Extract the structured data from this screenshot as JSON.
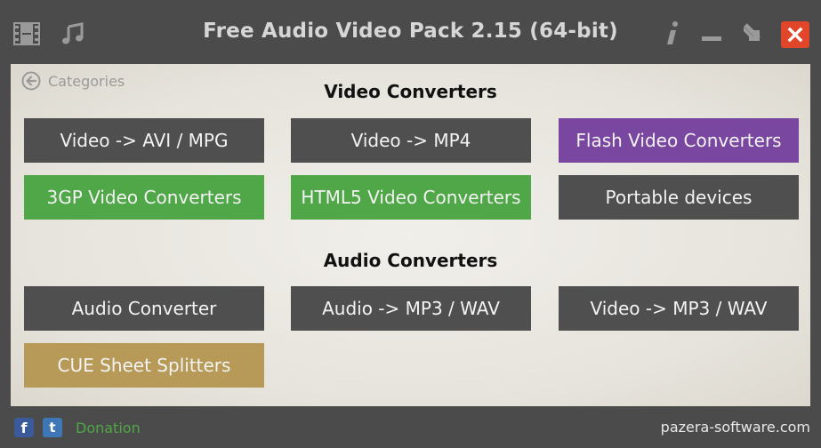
{
  "window": {
    "title": "Free Audio Video Pack 2.15 (64-bit)"
  },
  "titlebar_icons": [
    "film-icon",
    "music-note-icon",
    "info-icon",
    "minimize-icon",
    "restore-icon",
    "close-icon"
  ],
  "back": {
    "label": "Categories"
  },
  "video": {
    "heading": "Video Converters",
    "tiles": [
      {
        "label": "Video -> AVI / MPG",
        "color": "#4f4f4f"
      },
      {
        "label": "Video -> MP4",
        "color": "#4f4f4f"
      },
      {
        "label": "Flash Video Converters",
        "color": "#7a47a0"
      },
      {
        "label": "3GP Video Converters",
        "color": "#4fa747"
      },
      {
        "label": "HTML5 Video Converters",
        "color": "#4fa747"
      },
      {
        "label": "Portable devices",
        "color": "#4f4f4f"
      }
    ]
  },
  "audio": {
    "heading": "Audio Converters",
    "tiles": [
      {
        "label": "Audio Converter",
        "color": "#4f4f4f"
      },
      {
        "label": "Audio -> MP3 / WAV",
        "color": "#4f4f4f"
      },
      {
        "label": "Video -> MP3 / WAV",
        "color": "#4f4f4f"
      },
      {
        "label": "CUE Sheet Splitters",
        "color": "#b79a58"
      }
    ]
  },
  "footer": {
    "facebook_glyph": "f",
    "twitter_glyph": "t",
    "donation": "Donation",
    "site": "pazera-software.com"
  }
}
